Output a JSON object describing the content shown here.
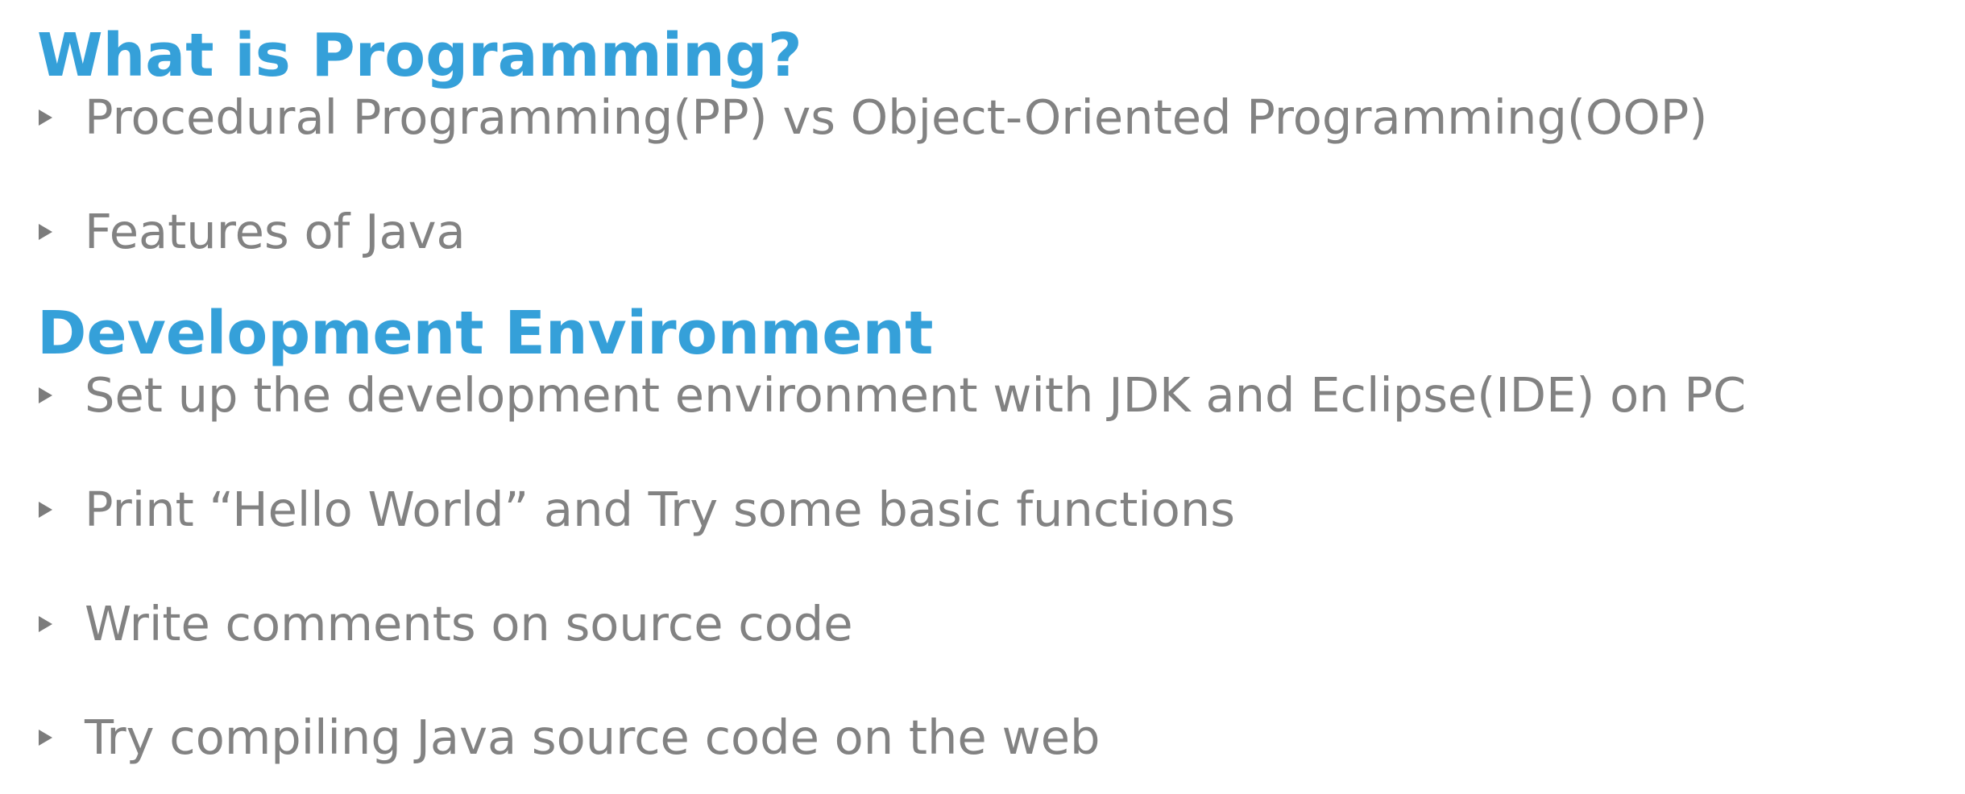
{
  "sections": [
    {
      "heading": "What is Programming?",
      "items": [
        "Procedural Programming(PP) vs Object-Oriented Programming(OOP)",
        "Features of Java"
      ]
    },
    {
      "heading": "Development Environment",
      "items": [
        "Set up the development environment with JDK and Eclipse(IDE) on PC",
        "Print “Hello World” and Try some basic functions",
        "Write comments on source code",
        "Try compiling Java source code on the web"
      ]
    }
  ],
  "colors": {
    "heading": "#35a0d9",
    "text": "#828282",
    "bullet_marker": "#7c7c7c"
  },
  "icons": {
    "bullet": "triangle-right-icon"
  }
}
